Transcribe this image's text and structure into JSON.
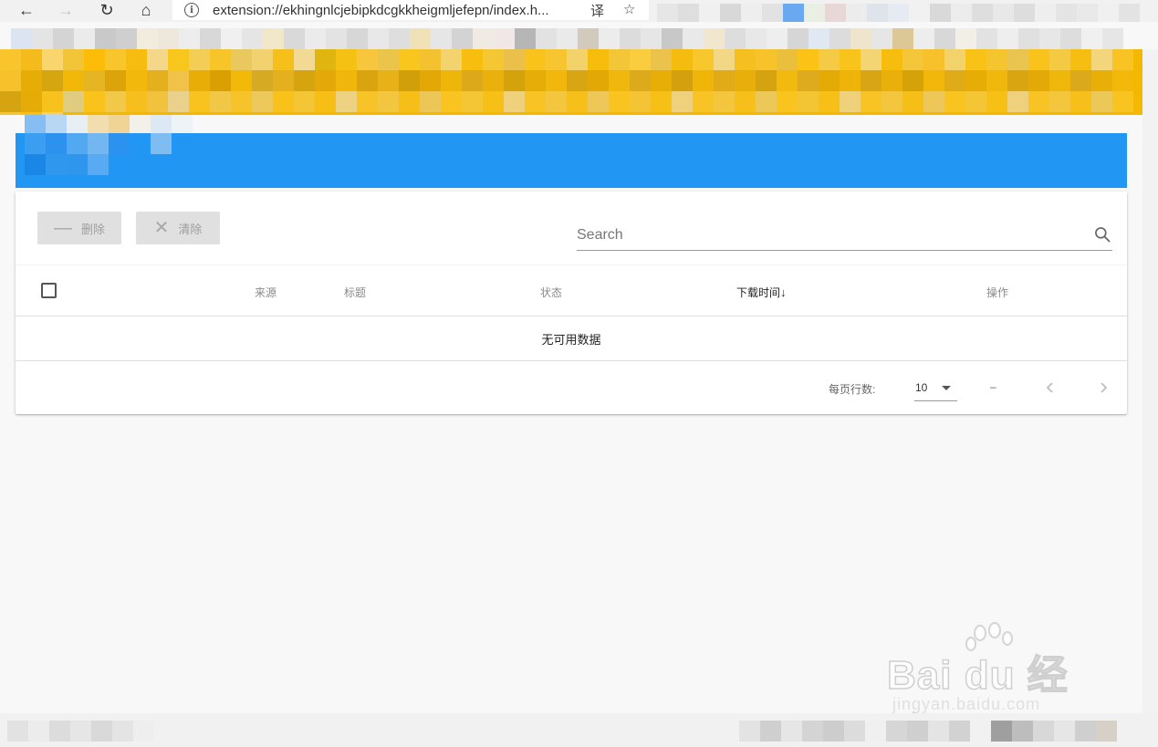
{
  "browser": {
    "address_url": "extension://ekhingnlcjebipkdcgkkheigmljefepn/index.h...",
    "nav_back": "←",
    "nav_forward": "→",
    "nav_reload": "↻",
    "nav_home": "⌂",
    "info_icon": "i",
    "translate_icon": "译",
    "favorite_icon": "☆"
  },
  "toolbar": {
    "delete_label": "删除",
    "delete_icon": "—",
    "clear_label": "清除",
    "clear_icon": "✕"
  },
  "search": {
    "placeholder": "Search",
    "value": ""
  },
  "table": {
    "columns": [
      {
        "label": "来源"
      },
      {
        "label": "标题"
      },
      {
        "label": "状态"
      },
      {
        "label": "下载时间",
        "sorted": "desc"
      },
      {
        "label": "操作"
      }
    ],
    "sort_indicator": "↓",
    "empty_text": "无可用数据"
  },
  "pagination": {
    "rows_per_page_label": "每页行数:",
    "rows_per_page_value": "10",
    "range_text": "–"
  },
  "watermark": {
    "brand": "Bai du 经验",
    "url": "jingyan.baidu.com"
  },
  "colors": {
    "header_blue": "#2196f3",
    "banner_yellow": "#f5b800"
  }
}
